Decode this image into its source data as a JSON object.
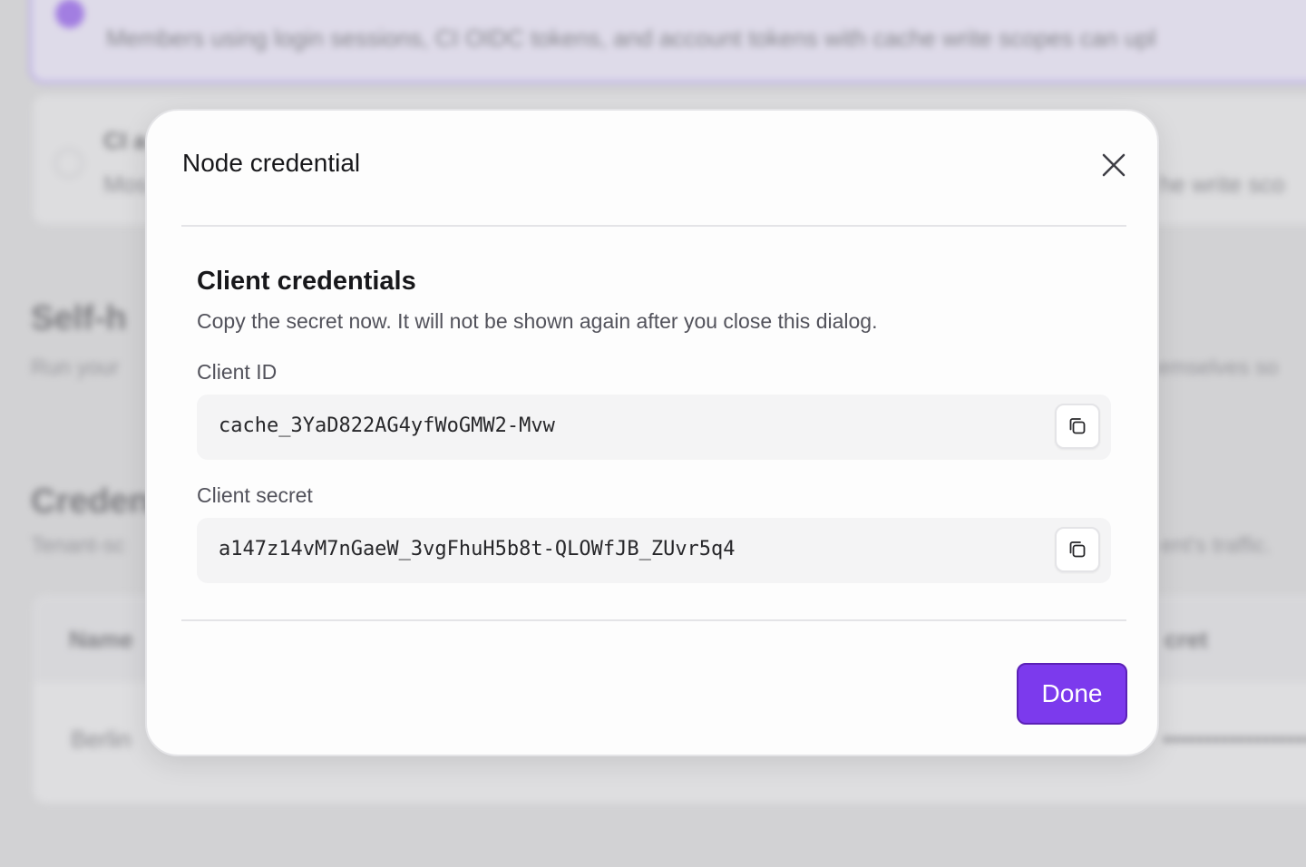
{
  "background": {
    "banner_text": "Members using login sessions, CI OIDC tokens, and account tokens with cache write scopes can upl",
    "option_title": "CI a",
    "option_desc_left": "Mos",
    "option_desc_right": "he write sco",
    "self_hosted_heading": "Self-h",
    "self_hosted_desc_left": "Run your",
    "self_hosted_desc_right": "emselves so",
    "credentials_heading": "Credent",
    "credentials_desc_left": "Tenant-sc",
    "credentials_desc_right": "ent's traffic.",
    "table_headers": [
      "Name",
      "cret"
    ],
    "table_row": {
      "name": "Berlin",
      "secret_mask": "••••••••••••••••••"
    }
  },
  "dialog": {
    "title": "Node credential",
    "section_title": "Client credentials",
    "section_description": "Copy the secret now. It will not be shown again after you close this dialog.",
    "client_id_label": "Client ID",
    "client_id_value": "cache_3YaD822AG4yfWoGMW2-Mvw",
    "client_secret_label": "Client secret",
    "client_secret_value": "a147z14vM7nGaeW_3vgFhuH5b8t-QLOWfJB_ZUvr5q4",
    "done_label": "Done"
  },
  "icons": {
    "close": "close-icon",
    "copy": "copy-icon",
    "banner": "info-icon"
  },
  "colors": {
    "accent": "#7c3aed",
    "accent_border": "#5b21b6",
    "banner_border": "#a78bfa",
    "overlay": "#d2d2d4"
  }
}
